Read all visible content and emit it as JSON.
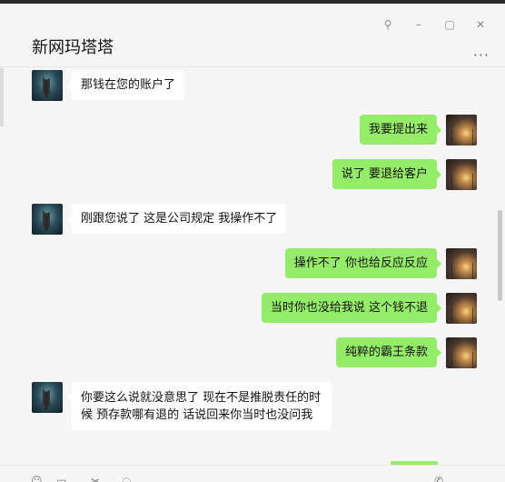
{
  "window": {
    "title": "新网玛塔塔",
    "controls": {
      "pin": "⚲",
      "minimize": "–",
      "maximize": "▢",
      "close": "✕"
    },
    "more": "···"
  },
  "messages": [
    {
      "side": "left",
      "avatar": "aurora-avatar",
      "text": "那钱在您的账户了"
    },
    {
      "side": "right",
      "avatar": "sunset-avatar",
      "text": "我要提出来"
    },
    {
      "side": "right",
      "avatar": "sunset-avatar",
      "text": "说了 要退给客户"
    },
    {
      "side": "left",
      "avatar": "aurora-avatar",
      "text": "刚跟您说了  这是公司规定   我操作不了"
    },
    {
      "side": "right",
      "avatar": "sunset-avatar",
      "text": "操作不了 你也给反应反应"
    },
    {
      "side": "right",
      "avatar": "sunset-avatar",
      "text": "当时你也没给我说 这个钱不退"
    },
    {
      "side": "right",
      "avatar": "sunset-avatar",
      "text": "纯粹的霸王条款"
    },
    {
      "side": "left",
      "avatar": "aurora-avatar",
      "text": "你要这么说就没意思了   现在不是推脱责任的时候    预存款哪有退的   话说回来你当时也没问我"
    }
  ],
  "toolbar": {
    "icons": [
      "emoji-icon",
      "folder-icon",
      "scissors-icon",
      "chat-history-icon",
      "phone-icon"
    ]
  },
  "colors": {
    "sent_bubble": "#95ec69",
    "received_bubble": "#ffffff",
    "background": "#f5f5f5"
  }
}
